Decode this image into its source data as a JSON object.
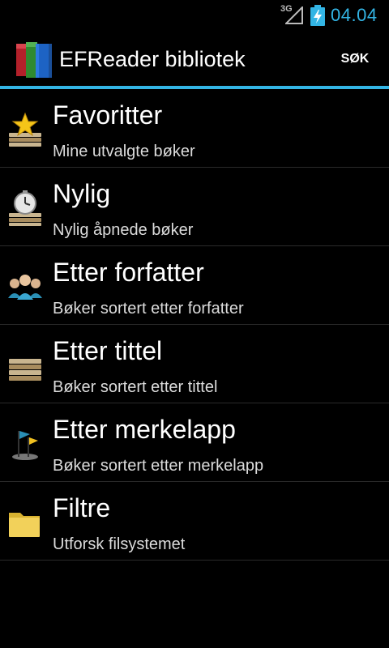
{
  "status_bar": {
    "network": "3G",
    "clock": "04.04"
  },
  "action_bar": {
    "title": "EFReader bibliotek",
    "search_label": "SØK"
  },
  "menu": {
    "items": [
      {
        "title": "Favoritter",
        "subtitle": "Mine utvalgte bøker",
        "icon": "favorites-icon"
      },
      {
        "title": "Nylig",
        "subtitle": "Nylig åpnede bøker",
        "icon": "recent-icon"
      },
      {
        "title": "Etter forfatter",
        "subtitle": "Bøker sortert etter forfatter",
        "icon": "authors-icon"
      },
      {
        "title": "Etter tittel",
        "subtitle": "Bøker sortert etter tittel",
        "icon": "titles-icon"
      },
      {
        "title": "Etter merkelapp",
        "subtitle": "Bøker sortert etter merkelapp",
        "icon": "tags-icon"
      },
      {
        "title": "Filtre",
        "subtitle": "Utforsk filsystemet",
        "icon": "folder-icon"
      }
    ]
  },
  "colors": {
    "accent": "#33b5e5",
    "background": "#000000"
  }
}
